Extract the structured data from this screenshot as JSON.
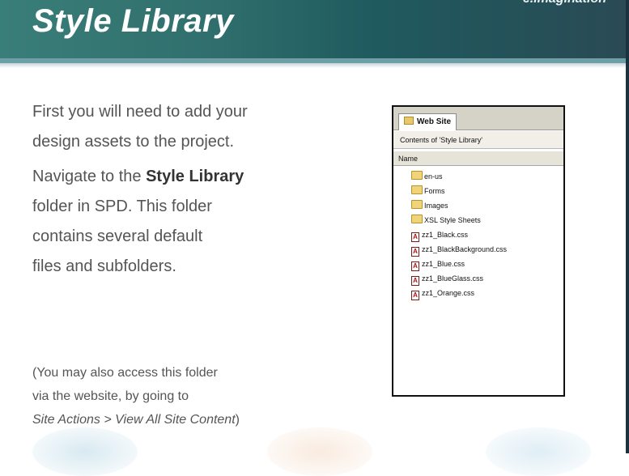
{
  "slide": {
    "title": "Style Library",
    "brand": "e.imagination",
    "para1_line1": "First you will need to add your",
    "para1_line2": "design assets to the project.",
    "para2_line1_pre": "Navigate to the ",
    "para2_line1_bold": "Style Library",
    "para2_line2": "folder in SPD.  This folder",
    "para2_line3": "contains several default",
    "para2_line4": "files and subfolders.",
    "note_line1": "(You may also access this folder",
    "note_line2": "via the website, by going to",
    "note_line3_italic": "Site Actions > View All Site Content",
    "note_line3_end": ")"
  },
  "panel": {
    "tab_label": "Web Site",
    "contents_label": "Contents of 'Style Library'",
    "column_header": "Name",
    "folders": [
      {
        "name": "en-us",
        "icon": "folder-icon"
      },
      {
        "name": "Forms",
        "icon": "folder-icon"
      },
      {
        "name": "Images",
        "icon": "folder-icon"
      },
      {
        "name": "XSL Style Sheets",
        "icon": "folder-icon"
      }
    ],
    "files": [
      {
        "name": "zz1_Black.css",
        "icon": "css-file-icon"
      },
      {
        "name": "zz1_BlackBackground.css",
        "icon": "css-file-icon"
      },
      {
        "name": "zz1_Blue.css",
        "icon": "css-file-icon"
      },
      {
        "name": "zz1_BlueGlass.css",
        "icon": "css-file-icon"
      },
      {
        "name": "zz1_Orange.css",
        "icon": "css-file-icon"
      }
    ]
  },
  "colors": {
    "header": "#2f6e6c",
    "text": "#555555"
  }
}
